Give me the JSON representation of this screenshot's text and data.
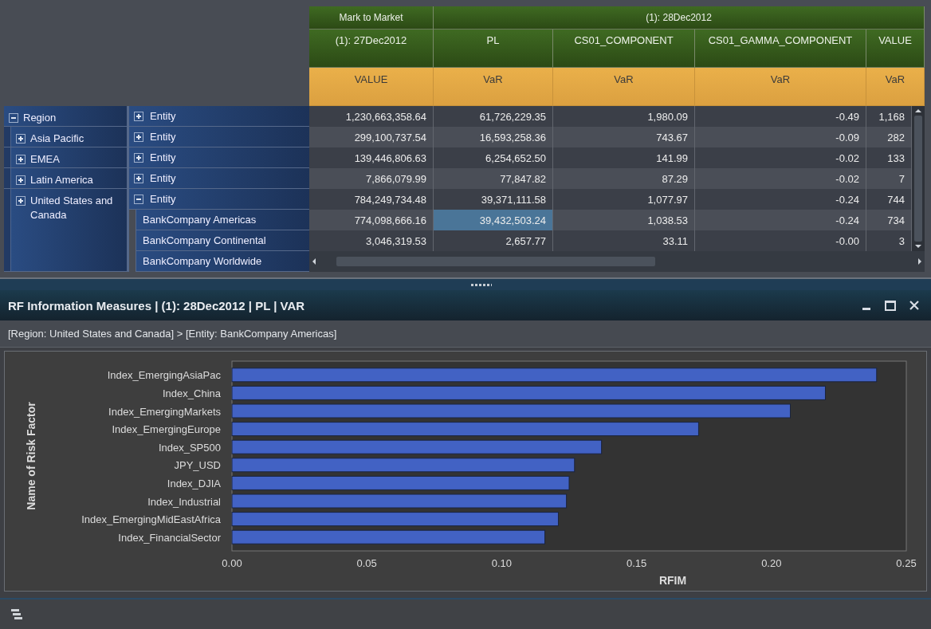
{
  "grid": {
    "header_groups": [
      {
        "label": "Mark to Market",
        "columns": [
          {
            "label": "(1): 27Dec2012",
            "measure": "VALUE"
          }
        ]
      },
      {
        "label": "(1): 28Dec2012",
        "columns": [
          {
            "label": "PL",
            "measure": "VaR"
          },
          {
            "label": "CS01_COMPONENT",
            "measure": "VaR"
          },
          {
            "label": "CS01_GAMMA_COMPONENT",
            "measure": "VaR"
          },
          {
            "label": "VALUE",
            "measure": "VaR"
          }
        ]
      }
    ],
    "row_tree": {
      "label": "Region",
      "expanded": true,
      "entity": {
        "label": "Entity",
        "expanded": false
      },
      "children": [
        {
          "label": "Asia Pacific",
          "expanded": false,
          "entity": {
            "label": "Entity",
            "expanded": false
          }
        },
        {
          "label": "EMEA",
          "expanded": false,
          "entity": {
            "label": "Entity",
            "expanded": false
          }
        },
        {
          "label": "Latin America",
          "expanded": false,
          "entity": {
            "label": "Entity",
            "expanded": false
          }
        },
        {
          "label": "United States and Canada",
          "expanded": false,
          "entity": {
            "label": "Entity",
            "expanded": true,
            "children": [
              "BankCompany Americas",
              "BankCompany Continental",
              "BankCompany Worldwide"
            ]
          }
        }
      ]
    },
    "data_rows": [
      [
        {
          "text": "1,230,663,358.64",
          "selected": false
        },
        {
          "text": "61,726,229.35",
          "selected": false
        },
        {
          "text": "1,980.09",
          "selected": false
        },
        {
          "text": "-0.49",
          "selected": false
        },
        {
          "text": "1,168",
          "selected": false
        }
      ],
      [
        {
          "text": "299,100,737.54",
          "selected": false
        },
        {
          "text": "16,593,258.36",
          "selected": false
        },
        {
          "text": "743.67",
          "selected": false
        },
        {
          "text": "-0.09",
          "selected": false
        },
        {
          "text": "282",
          "selected": false
        }
      ],
      [
        {
          "text": "139,446,806.63",
          "selected": false
        },
        {
          "text": "6,254,652.50",
          "selected": false
        },
        {
          "text": "141.99",
          "selected": false
        },
        {
          "text": "-0.02",
          "selected": false
        },
        {
          "text": "133",
          "selected": false
        }
      ],
      [
        {
          "text": "7,866,079.99",
          "selected": false
        },
        {
          "text": "77,847.82",
          "selected": false
        },
        {
          "text": "87.29",
          "selected": false
        },
        {
          "text": "-0.02",
          "selected": false
        },
        {
          "text": "7",
          "selected": false
        }
      ],
      [
        {
          "text": "784,249,734.48",
          "selected": false
        },
        {
          "text": "39,371,111.58",
          "selected": false
        },
        {
          "text": "1,077.97",
          "selected": false
        },
        {
          "text": "-0.24",
          "selected": false
        },
        {
          "text": "744",
          "selected": false
        }
      ],
      [
        {
          "text": "774,098,666.16",
          "selected": false
        },
        {
          "text": "39,432,503.24",
          "selected": true
        },
        {
          "text": "1,038.53",
          "selected": false
        },
        {
          "text": "-0.24",
          "selected": false
        },
        {
          "text": "734",
          "selected": false
        }
      ],
      [
        {
          "text": "3,046,319.53",
          "selected": false
        },
        {
          "text": "2,657.77",
          "selected": false
        },
        {
          "text": "33.11",
          "selected": false
        },
        {
          "text": "-0.00",
          "selected": false
        },
        {
          "text": "3",
          "selected": false
        }
      ]
    ]
  },
  "panel": {
    "title": "RF Information Measures | (1): 28Dec2012 | PL | VAR",
    "breadcrumb": "[Region: United States and Canada] > [Entity: BankCompany Americas]",
    "chart_data": {
      "type": "bar",
      "orientation": "horizontal",
      "xlabel": "RFIM",
      "ylabel": "Name of Risk Factor",
      "categories": [
        "Index_EmergingAsiaPac",
        "Index_China",
        "Index_EmergingMarkets",
        "Index_EmergingEurope",
        "Index_SP500",
        "JPY_USD",
        "Index_DJIA",
        "Index_Industrial",
        "Index_EmergingMidEastAfrica",
        "Index_FinancialSector"
      ],
      "values": [
        0.239,
        0.22,
        0.207,
        0.173,
        0.137,
        0.127,
        0.125,
        0.124,
        0.121,
        0.116
      ],
      "xlim": [
        0,
        0.25
      ],
      "xticks": [
        {
          "value": 0,
          "label": "0.00"
        },
        {
          "value": 0.05,
          "label": "0.05"
        },
        {
          "value": 0.1,
          "label": "0.10"
        },
        {
          "value": 0.15,
          "label": "0.15"
        },
        {
          "value": 0.2,
          "label": "0.20"
        },
        {
          "value": 0.25,
          "label": "0.25"
        }
      ]
    }
  }
}
